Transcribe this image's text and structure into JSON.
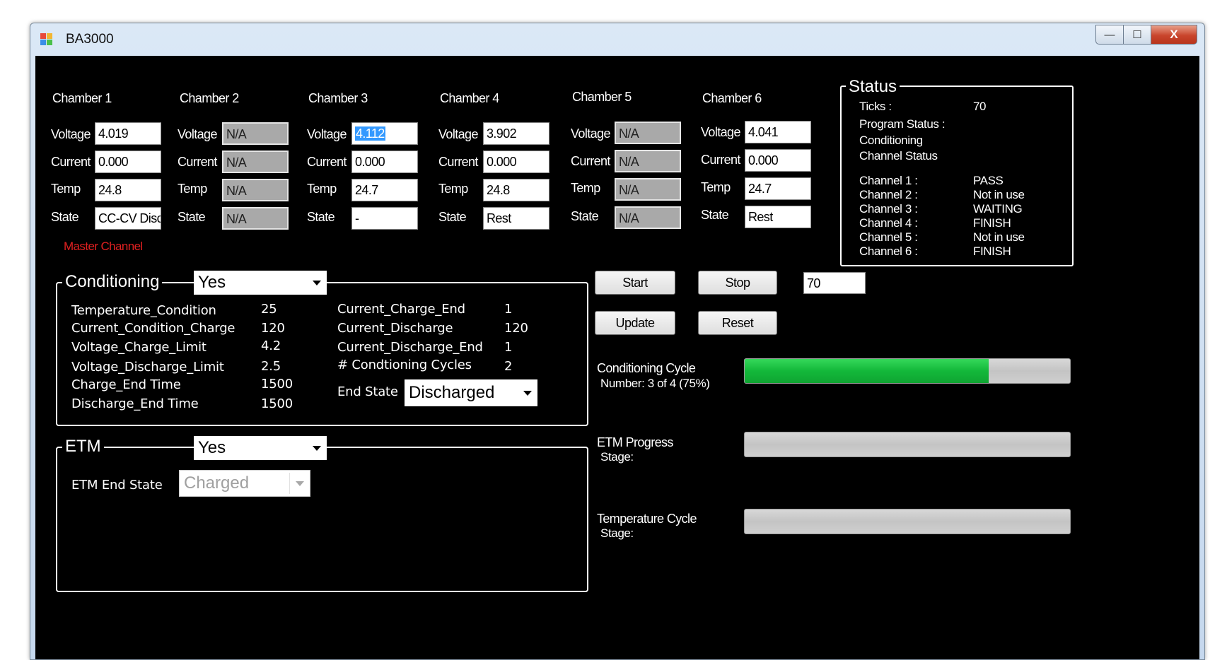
{
  "window": {
    "title": "BA3000",
    "minimize_glyph": "—",
    "maximize_glyph": "☐",
    "close_glyph": "X"
  },
  "chambers": [
    {
      "title": "Chamber 1",
      "voltage_label": "Voltage",
      "current_label": "Current",
      "temp_label": "Temp",
      "state_label": "State",
      "voltage": "4.019",
      "current": "0.000",
      "temp": "24.8",
      "state": "CC-CV Discharge",
      "note": "Master Channel"
    },
    {
      "title": "Chamber 2",
      "voltage_label": "Voltage",
      "current_label": "Current",
      "temp_label": "Temp",
      "state_label": "State",
      "voltage": "N/A",
      "current": "N/A",
      "temp": "N/A",
      "state": "N/A"
    },
    {
      "title": "Chamber 3",
      "voltage_label": "Voltage",
      "current_label": "Current",
      "temp_label": "Temp",
      "state_label": "State",
      "voltage": "4.112",
      "current": "0.000",
      "temp": "24.7",
      "state": "-"
    },
    {
      "title": "Chamber 4",
      "voltage_label": "Voltage",
      "current_label": "Current",
      "temp_label": "Temp",
      "state_label": "State",
      "voltage": "3.902",
      "current": "0.000",
      "temp": "24.8",
      "state": "Rest"
    },
    {
      "title": "Chamber 5",
      "voltage_label": "Voltage",
      "current_label": "Current",
      "temp_label": "Temp",
      "state_label": "State",
      "voltage": "N/A",
      "current": "N/A",
      "temp": "N/A",
      "state": "N/A"
    },
    {
      "title": "Chamber 6",
      "voltage_label": "Voltage",
      "current_label": "Current",
      "temp_label": "Temp",
      "state_label": "State",
      "voltage": "4.041",
      "current": "0.000",
      "temp": "24.7",
      "state": "Rest"
    }
  ],
  "status": {
    "title": "Status",
    "ticks_label": "Ticks :",
    "ticks_value": "70",
    "program_status_label": "Program Status :",
    "program_status_value": "Conditioning",
    "channel_status_label": "Channel Status",
    "channels": [
      {
        "label": "Channel 1 :",
        "value": "PASS"
      },
      {
        "label": "Channel 2 :",
        "value": "Not in use"
      },
      {
        "label": "Channel 3 :",
        "value": "WAITING"
      },
      {
        "label": "Channel 4 :",
        "value": "FINISH"
      },
      {
        "label": "Channel 5 :",
        "value": "Not in use"
      },
      {
        "label": "Channel 6 :",
        "value": "FINISH"
      }
    ]
  },
  "conditioning": {
    "title": "Conditioning",
    "enabled": "Yes",
    "params_left": [
      {
        "name": "Temperature_Condition",
        "value": "25"
      },
      {
        "name": "Current_Condition_Charge",
        "value": "120"
      },
      {
        "name": "Voltage_Charge_Limit",
        "value": "4.2"
      },
      {
        "name": "Voltage_Discharge_Limit",
        "value": "2.5"
      },
      {
        "name": "Charge_End Time",
        "value": "1500"
      },
      {
        "name": "Discharge_End Time",
        "value": "1500"
      }
    ],
    "params_right": [
      {
        "name": "Current_Charge_End",
        "value": "1"
      },
      {
        "name": "Current_Discharge",
        "value": "120"
      },
      {
        "name": "Current_Discharge_End",
        "value": "1"
      },
      {
        "name": "# Condtioning Cycles",
        "value": "2"
      }
    ],
    "end_state_label": "End State",
    "end_state_value": "Discharged"
  },
  "etm": {
    "title": "ETM",
    "enabled": "Yes",
    "end_state_label": "ETM End State",
    "end_state_value": "Charged"
  },
  "controls": {
    "start_label": "Start",
    "stop_label": "Stop",
    "update_label": "Update",
    "reset_label": "Reset",
    "ticks_input": "70"
  },
  "progress": {
    "conditioning_label_1": "Conditioning Cycle",
    "conditioning_label_2": "Number: 3 of 4 (75%)",
    "conditioning_fraction": 0.75,
    "etm_label_1": "ETM Progress",
    "etm_label_2": "Stage:",
    "etm_fraction": 0,
    "temp_label_1": "Temperature Cycle",
    "temp_label_2": "Stage:",
    "temp_fraction": 0
  },
  "colors": {
    "progress_fill": "#13b83a",
    "master_channel_text": "#e02020",
    "selection_highlight": "#3399ff"
  }
}
